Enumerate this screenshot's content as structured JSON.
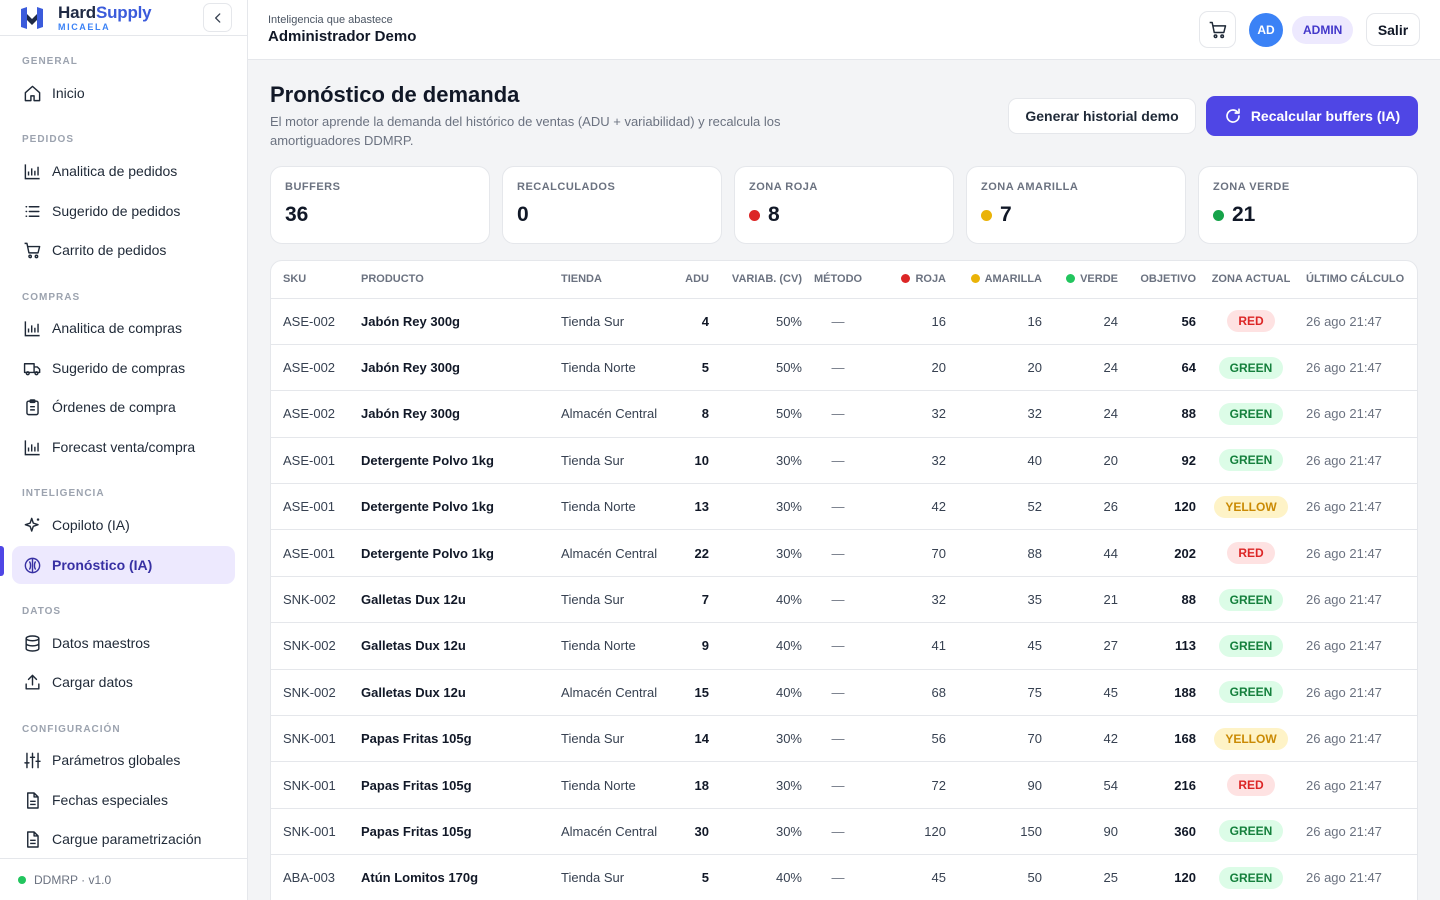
{
  "brand": {
    "name_part1": "Hard",
    "name_part2": "Supply",
    "sub": "MICAELA"
  },
  "topbar": {
    "subtitle": "Inteligencia que abastece",
    "title": "Administrador Demo",
    "avatar": "AD",
    "role": "ADMIN",
    "logout": "Salir"
  },
  "nav": {
    "sections": [
      "GENERAL",
      "PEDIDOS",
      "COMPRAS",
      "INTELIGENCIA",
      "DATOS",
      "CONFIGURACIÓN"
    ],
    "items": [
      {
        "label": "Inicio",
        "icon": "home-icon"
      },
      {
        "label": "Analitica de pedidos",
        "icon": "bar-chart-icon"
      },
      {
        "label": "Sugerido de pedidos",
        "icon": "list-icon"
      },
      {
        "label": "Carrito de pedidos",
        "icon": "cart-icon"
      },
      {
        "label": "Analitica de compras",
        "icon": "bar-chart-icon"
      },
      {
        "label": "Sugerido de compras",
        "icon": "truck-icon"
      },
      {
        "label": "Órdenes de compra",
        "icon": "clipboard-icon"
      },
      {
        "label": "Forecast venta/compra",
        "icon": "bar-chart-icon"
      },
      {
        "label": "Copiloto (IA)",
        "icon": "sparkle-icon"
      },
      {
        "label": "Pronóstico (IA)",
        "icon": "brain-icon"
      },
      {
        "label": "Datos maestros",
        "icon": "database-icon"
      },
      {
        "label": "Cargar datos",
        "icon": "upload-icon"
      },
      {
        "label": "Parámetros globales",
        "icon": "sliders-icon"
      },
      {
        "label": "Fechas especiales",
        "icon": "file-icon"
      },
      {
        "label": "Cargue parametrización",
        "icon": "file-icon"
      }
    ],
    "footer": "DDMRP · v1.0"
  },
  "page": {
    "title": "Pronóstico de demanda",
    "description": "El motor aprende la demanda del histórico de ventas (ADU + variabilidad) y recalcula los amortiguadores DDMRP.",
    "btn_demo": "Generar historial demo",
    "btn_recalc": "Recalcular buffers (IA)"
  },
  "stats": [
    {
      "label": "BUFFERS",
      "value": "36",
      "dot": ""
    },
    {
      "label": "RECALCULADOS",
      "value": "0",
      "dot": ""
    },
    {
      "label": "ZONA ROJA",
      "value": "8",
      "dot": "#dc2626"
    },
    {
      "label": "ZONA AMARILLA",
      "value": "7",
      "dot": "#eab308"
    },
    {
      "label": "ZONA VERDE",
      "value": "21",
      "dot": "#16a34a"
    }
  ],
  "table": {
    "headers": [
      "SKU",
      "PRODUCTO",
      "TIENDA",
      "ADU",
      "VARIAB. (CV)",
      "MÉTODO",
      "ROJA",
      "AMARILLA",
      "VERDE",
      "OBJETIVO",
      "ZONA ACTUAL",
      "ÚLTIMO CÁLCULO"
    ],
    "rows": [
      [
        "ASE-002",
        "Jabón Rey 300g",
        "Tienda Sur",
        "4",
        "50%",
        "—",
        "16",
        "16",
        "24",
        "56",
        "RED",
        "26 ago 21:47"
      ],
      [
        "ASE-002",
        "Jabón Rey 300g",
        "Tienda Norte",
        "5",
        "50%",
        "—",
        "20",
        "20",
        "24",
        "64",
        "GREEN",
        "26 ago 21:47"
      ],
      [
        "ASE-002",
        "Jabón Rey 300g",
        "Almacén Central",
        "8",
        "50%",
        "—",
        "32",
        "32",
        "24",
        "88",
        "GREEN",
        "26 ago 21:47"
      ],
      [
        "ASE-001",
        "Detergente Polvo 1kg",
        "Tienda Sur",
        "10",
        "30%",
        "—",
        "32",
        "40",
        "20",
        "92",
        "GREEN",
        "26 ago 21:47"
      ],
      [
        "ASE-001",
        "Detergente Polvo 1kg",
        "Tienda Norte",
        "13",
        "30%",
        "—",
        "42",
        "52",
        "26",
        "120",
        "YELLOW",
        "26 ago 21:47"
      ],
      [
        "ASE-001",
        "Detergente Polvo 1kg",
        "Almacén Central",
        "22",
        "30%",
        "—",
        "70",
        "88",
        "44",
        "202",
        "RED",
        "26 ago 21:47"
      ],
      [
        "SNK-002",
        "Galletas Dux 12u",
        "Tienda Sur",
        "7",
        "40%",
        "—",
        "32",
        "35",
        "21",
        "88",
        "GREEN",
        "26 ago 21:47"
      ],
      [
        "SNK-002",
        "Galletas Dux 12u",
        "Tienda Norte",
        "9",
        "40%",
        "—",
        "41",
        "45",
        "27",
        "113",
        "GREEN",
        "26 ago 21:47"
      ],
      [
        "SNK-002",
        "Galletas Dux 12u",
        "Almacén Central",
        "15",
        "40%",
        "—",
        "68",
        "75",
        "45",
        "188",
        "GREEN",
        "26 ago 21:47"
      ],
      [
        "SNK-001",
        "Papas Fritas 105g",
        "Tienda Sur",
        "14",
        "30%",
        "—",
        "56",
        "70",
        "42",
        "168",
        "YELLOW",
        "26 ago 21:47"
      ],
      [
        "SNK-001",
        "Papas Fritas 105g",
        "Tienda Norte",
        "18",
        "30%",
        "—",
        "72",
        "90",
        "54",
        "216",
        "RED",
        "26 ago 21:47"
      ],
      [
        "SNK-001",
        "Papas Fritas 105g",
        "Almacén Central",
        "30",
        "30%",
        "—",
        "120",
        "150",
        "90",
        "360",
        "GREEN",
        "26 ago 21:47"
      ],
      [
        "ABA-003",
        "Atún Lomitos 170g",
        "Tienda Sur",
        "5",
        "40%",
        "—",
        "45",
        "50",
        "25",
        "120",
        "GREEN",
        "26 ago 21:47"
      ]
    ]
  },
  "colors": {
    "accent": "#4f46e5",
    "red": "#dc2626",
    "yellow": "#eab308",
    "green": "#16a34a"
  }
}
